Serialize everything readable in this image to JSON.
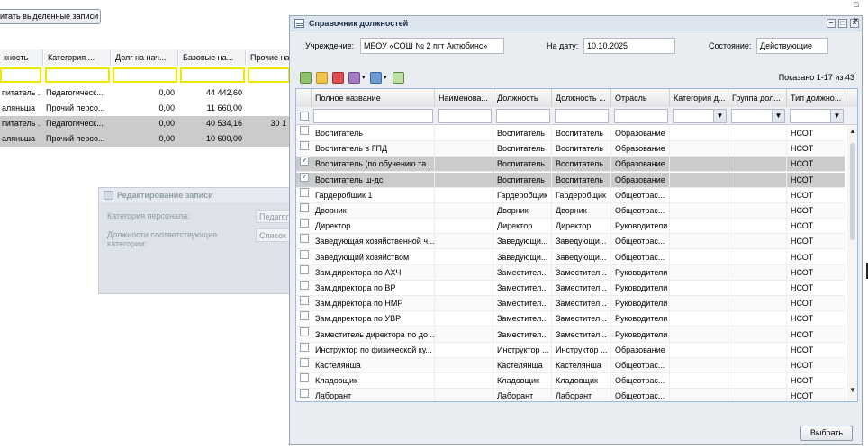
{
  "background": {
    "calc_button": "итать выделенные записи",
    "columns": [
      "кность",
      "Категория ...",
      "Долг на нач...",
      "Базовые на...",
      "Прочие на"
    ],
    "rows": [
      [
        "питатель ...",
        "Педагогическ...",
        "0,00",
        "44 442,60",
        ""
      ],
      [
        "аляньша",
        "Прочий персо...",
        "0,00",
        "11 660,00",
        ""
      ],
      [
        "питатель ...",
        "Педагогическ...",
        "0,00",
        "40 534,16",
        "30 1"
      ],
      [
        "аляньша",
        "Прочий персо...",
        "0,00",
        "10 600,00",
        ""
      ]
    ]
  },
  "edit_dialog": {
    "title": "Редактирование записи",
    "category_label": "Категория персонала:",
    "category_value": "Педагог",
    "positions_label": "Должности соответствующие категории:",
    "positions_value": "Список"
  },
  "window": {
    "title": "Справочник должностей",
    "institution_label": "Учреждение:",
    "institution_value": "МБОУ «СОШ № 2 пгт Актюбинс»",
    "date_label": "На дату:",
    "date_value": "10.10.2025",
    "state_label": "Состояние:",
    "state_value": "Действующие",
    "paging_text": "Показано 1-17 из 43",
    "select_button": "Выбрать"
  },
  "grid": {
    "columns": [
      "Полное название",
      "Наименова...",
      "Должность",
      "Должность ...",
      "Отрасль",
      "Категория д...",
      "Группа дол...",
      "Тип должно..."
    ],
    "rows": [
      {
        "name": "Воспитатель",
        "short": "",
        "position": "Воспитатель",
        "position2": "Воспитатель",
        "branch": "Образование",
        "category": "",
        "group": "",
        "type": "НСОТ",
        "checked": false
      },
      {
        "name": "Воспитатель в ГПД",
        "short": "",
        "position": "Воспитатель",
        "position2": "Воспитатель",
        "branch": "Образование",
        "category": "",
        "group": "",
        "type": "НСОТ",
        "checked": false
      },
      {
        "name": "Воспитатель (по обучению та...",
        "short": "",
        "position": "Воспитатель",
        "position2": "Воспитатель",
        "branch": "Образование",
        "category": "",
        "group": "",
        "type": "НСОТ",
        "checked": true
      },
      {
        "name": "Воспитатель ш-дс",
        "short": "",
        "position": "Воспитатель",
        "position2": "Воспитатель",
        "branch": "Образование",
        "category": "",
        "group": "",
        "type": "НСОТ",
        "checked": true
      },
      {
        "name": "Гардеробщик 1",
        "short": "",
        "position": "Гардеробщик",
        "position2": "Гардеробщик",
        "branch": "Общеотрас...",
        "category": "",
        "group": "",
        "type": "НСОТ",
        "checked": false
      },
      {
        "name": "Дворник",
        "short": "",
        "position": "Дворник",
        "position2": "Дворник",
        "branch": "Общеотрас...",
        "category": "",
        "group": "",
        "type": "НСОТ",
        "checked": false
      },
      {
        "name": "Директор",
        "short": "",
        "position": "Директор",
        "position2": "Директор",
        "branch": "Руководители",
        "category": "",
        "group": "",
        "type": "НСОТ",
        "checked": false
      },
      {
        "name": "Заведующая хозяйственной ч...",
        "short": "",
        "position": "Заведующи...",
        "position2": "Заведующи...",
        "branch": "Общеотрас...",
        "category": "",
        "group": "",
        "type": "НСОТ",
        "checked": false
      },
      {
        "name": "Заведующий хозяйством",
        "short": "",
        "position": "Заведующи...",
        "position2": "Заведующи...",
        "branch": "Общеотрас...",
        "category": "",
        "group": "",
        "type": "НСОТ",
        "checked": false
      },
      {
        "name": "Зам.директора по АХЧ",
        "short": "",
        "position": "Заместител...",
        "position2": "Заместител...",
        "branch": "Руководители",
        "category": "",
        "group": "",
        "type": "НСОТ",
        "checked": false
      },
      {
        "name": "Зам.директора по ВР",
        "short": "",
        "position": "Заместител...",
        "position2": "Заместител...",
        "branch": "Руководители",
        "category": "",
        "group": "",
        "type": "НСОТ",
        "checked": false
      },
      {
        "name": "Зам.директора по НМР",
        "short": "",
        "position": "Заместител...",
        "position2": "Заместител...",
        "branch": "Руководители",
        "category": "",
        "group": "",
        "type": "НСОТ",
        "checked": false
      },
      {
        "name": "Зам.директора по УВР",
        "short": "",
        "position": "Заместител...",
        "position2": "Заместител...",
        "branch": "Руководители",
        "category": "",
        "group": "",
        "type": "НСОТ",
        "checked": false
      },
      {
        "name": "Заместитель директора по до...",
        "short": "",
        "position": "Заместител...",
        "position2": "Заместител...",
        "branch": "Руководители",
        "category": "",
        "group": "",
        "type": "НСОТ",
        "checked": false
      },
      {
        "name": "Инструктор по физической ку...",
        "short": "",
        "position": "Инструктор ...",
        "position2": "Инструктор ...",
        "branch": "Образование",
        "category": "",
        "group": "",
        "type": "НСОТ",
        "checked": false
      },
      {
        "name": "Кастелянша",
        "short": "",
        "position": "Кастелянша",
        "position2": "Кастелянша",
        "branch": "Общеотрас...",
        "category": "",
        "group": "",
        "type": "НСОТ",
        "checked": false
      },
      {
        "name": "Кладовщик",
        "short": "",
        "position": "Кладовщик",
        "position2": "Кладовщик",
        "branch": "Общеотрас...",
        "category": "",
        "group": "",
        "type": "НСОТ",
        "checked": false
      },
      {
        "name": "Лаборант",
        "short": "",
        "position": "Лаборант",
        "position2": "Лаборант",
        "branch": "Общеотрас...",
        "category": "",
        "group": "",
        "type": "НСОТ",
        "checked": false
      }
    ]
  },
  "colors": {
    "selected_row": "#c9cbcd",
    "filter_highlight": "#f2e500",
    "header_bg": "#dde5ee"
  }
}
